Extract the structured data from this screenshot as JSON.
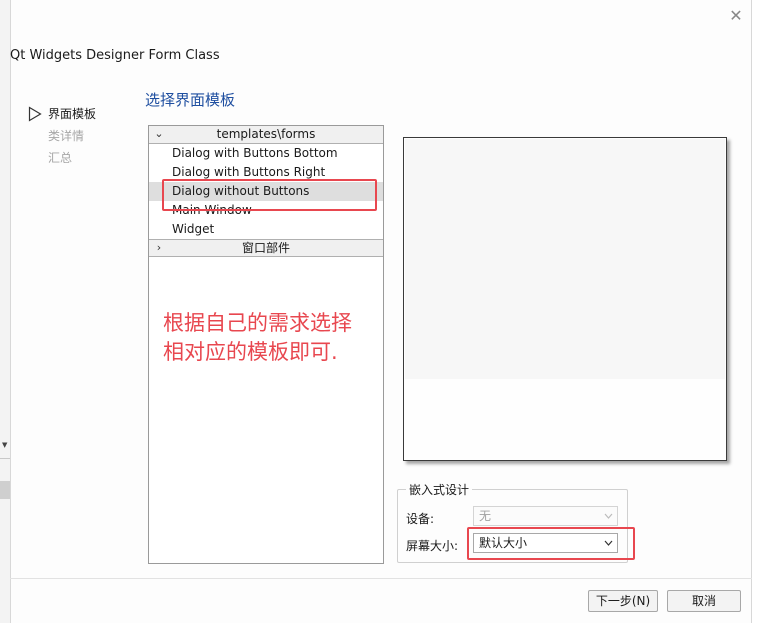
{
  "window": {
    "title": "Qt Widgets Designer Form Class"
  },
  "steps": [
    {
      "label": "界面模板",
      "active": true
    },
    {
      "label": "类详情",
      "active": false
    },
    {
      "label": "汇总",
      "active": false
    }
  ],
  "page": {
    "title": "选择界面模板"
  },
  "template_tree": {
    "category_1": {
      "label": "templates\\forms",
      "chevron": "⌄"
    },
    "items": [
      {
        "label": "Dialog with Buttons Bottom"
      },
      {
        "label": "Dialog with Buttons Right"
      },
      {
        "label": "Dialog without Buttons"
      },
      {
        "label": "Main Window"
      },
      {
        "label": "Widget"
      }
    ],
    "selected_item": "Dialog without Buttons",
    "category_2": {
      "label": "窗口部件",
      "chevron": "›"
    }
  },
  "annotation": {
    "text_line1": "根据自己的需求选择",
    "text_line2": "相对应的模板即可."
  },
  "embedded": {
    "group_title": "嵌入式设计",
    "device_label": "设备:",
    "device_value": "无",
    "screen_label": "屏幕大小:",
    "screen_value": "默认大小"
  },
  "buttons": {
    "next": "下一步(N)",
    "cancel": "取消"
  },
  "colors": {
    "accent_title": "#1f4fa0",
    "annotation_red": "#e8474f",
    "selection": "#dedede"
  },
  "icons": {
    "close": "close-icon",
    "step_current": "triangle-right-outline-icon",
    "expand": "chevron-down-icon",
    "collapse": "chevron-right-icon",
    "dropdown": "chevron-down-icon"
  }
}
